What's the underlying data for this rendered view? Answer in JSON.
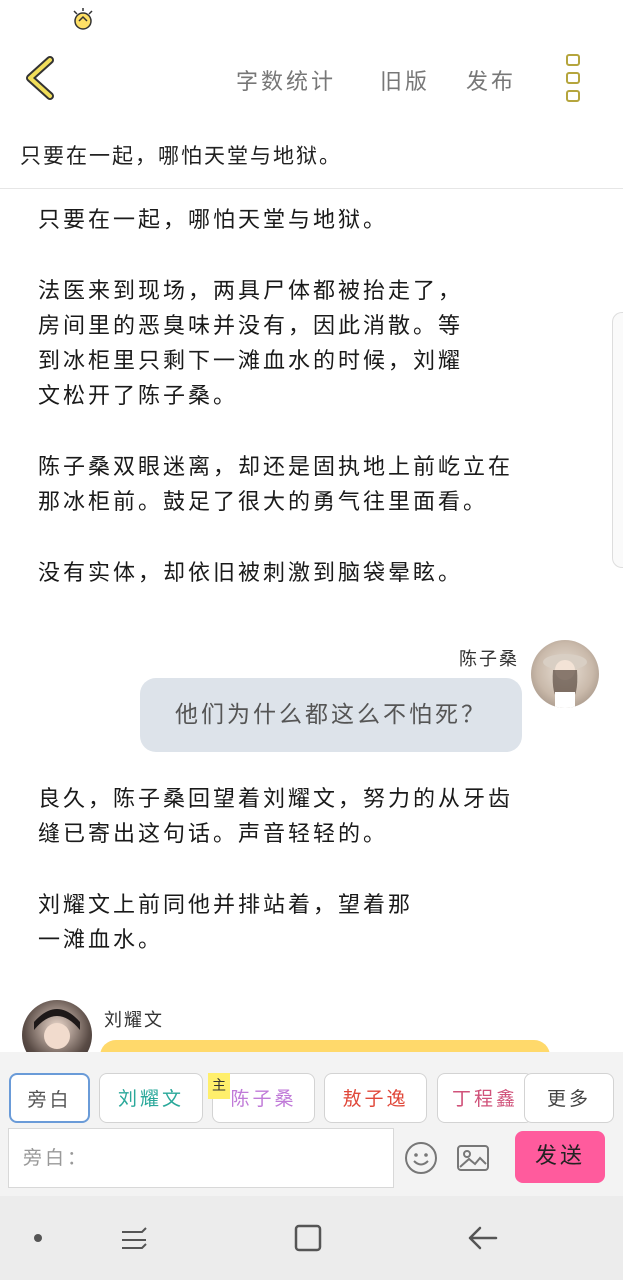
{
  "topbar": {
    "word_count": "字数统计",
    "old_version": "旧版",
    "publish": "发布"
  },
  "story_title": "只要在一起，哪怕天堂与地狱。",
  "content": {
    "paragraphs": [
      "只要在一起，哪怕天堂与地狱。",
      "法医来到现场，两具尸体都被抬走了，\n房间里的恶臭味并没有，因此消散。等\n到冰柜里只剩下一滩血水的时候，刘耀\n文松开了陈子桑。",
      "陈子桑双眼迷离，却还是固执地上前屹立在\n那冰柜前。鼓足了很大的勇气往里面看。",
      "没有实体，却依旧被刺激到脑袋晕眩。"
    ],
    "dialogue_right": {
      "speaker": "陈子桑",
      "text": "他们为什么都这么不怕死？"
    },
    "paragraphs_after": [
      "良久，陈子桑回望着刘耀文，努力的从牙齿\n缝已寄出这句话。声音轻轻的。",
      "刘耀文上前同他并排站着，望着那\n一滩血水。"
    ],
    "dialogue_left": {
      "speaker": "刘耀文"
    }
  },
  "roles": {
    "narration": "旁白",
    "role1": "刘耀文",
    "role2": "陈子桑",
    "role2_badge": "主",
    "role3": "敖子逸",
    "role4": "丁程鑫",
    "more": "更多",
    "colors": {
      "narration": "#555555",
      "role1": "#2aa89a",
      "role2": "#c07ad8",
      "role3": "#e0483a",
      "role4": "#d0527a",
      "send": "#ff5b9d"
    }
  },
  "input": {
    "placeholder": "旁白："
  },
  "send_label": "发送"
}
